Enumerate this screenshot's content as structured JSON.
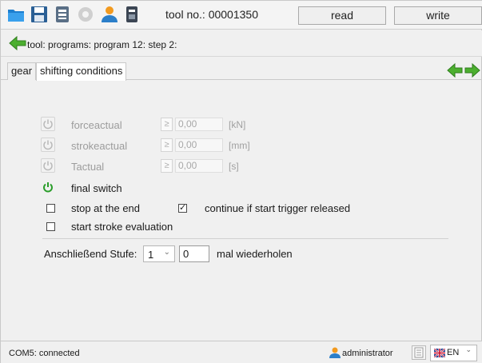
{
  "toolbar": {
    "tool_no_label": "tool no.: 00001350",
    "read_label": "read",
    "write_label": "write",
    "icons": [
      "folder-icon",
      "save-icon",
      "print-icon",
      "settings-icon",
      "user-icon",
      "device-icon"
    ]
  },
  "breadcrumb": {
    "text": "tool: programs: program 12: step 2:"
  },
  "tabs": [
    {
      "label": "gear",
      "active": false
    },
    {
      "label": "shifting conditions",
      "active": true
    }
  ],
  "conditions": [
    {
      "label": "forceactual",
      "op": "≥",
      "value": "0,00",
      "unit": "[kN]",
      "enabled": false
    },
    {
      "label": "strokeactual",
      "op": "≥",
      "value": "0,00",
      "unit": "[mm]",
      "enabled": false
    },
    {
      "label": "Tactual",
      "op": "≥",
      "value": "0,00",
      "unit": "[s]",
      "enabled": false
    }
  ],
  "final_switch": {
    "label": "final switch",
    "active": true
  },
  "options": {
    "stop_at_end": {
      "label": "stop at the end",
      "checked": false
    },
    "continue_if_released": {
      "label": "continue if start trigger released",
      "checked": true
    },
    "start_stroke_eval": {
      "label": "start stroke evaluation",
      "checked": false
    }
  },
  "subsequent": {
    "label": "Anschließend Stufe:",
    "stage_value": "1",
    "repeat_value": "0",
    "repeat_label": "mal wiederholen"
  },
  "status_bar": {
    "connection": "COM5: connected",
    "user": "administrator",
    "language": "EN"
  },
  "colors": {
    "accent_green": "#2a9d2a",
    "arrow_green": "#4caf2f",
    "folder_blue": "#2f8fd6"
  }
}
